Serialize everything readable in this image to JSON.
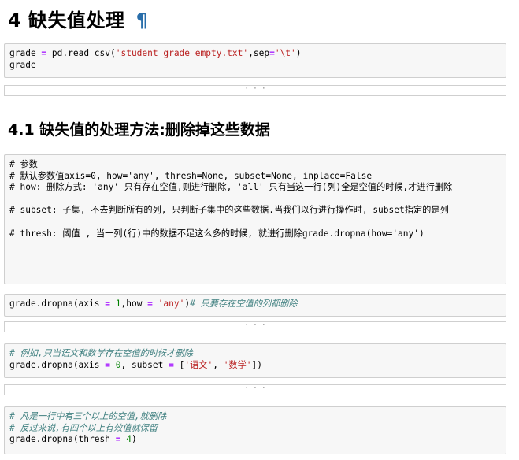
{
  "heading1": {
    "text": "4  缺失值处理",
    "pilcrow": "¶"
  },
  "heading2": {
    "text": "4.1  缺失值的处理方法:删除掉这些数据"
  },
  "cell1": {
    "line1_a": "grade ",
    "line1_eq": "=",
    "line1_b": " pd.read_csv(",
    "line1_str1": "'student_grade_empty.txt'",
    "line1_c": ",sep",
    "line1_eq2": "=",
    "line1_str2": "'\\t'",
    "line1_d": ")",
    "line2": "grade"
  },
  "cell2": {
    "text": "# 参数\n# 默认参数值axis=0, how='any', thresh=None, subset=None, inplace=False\n# how: 删除方式: 'any' 只有存在空值,则进行删除, 'all' 只有当这一行(列)全是空值的时候,才进行删除\n\n# subset: 子集, 不去判断所有的列, 只判断子集中的这些数据.当我们以行进行操作时, subset指定的是列\n\n# thresh: 阈值 , 当一列(行)中的数据不足这么多的时候, 就进行删除grade.dropna(how='any')"
  },
  "cell3": {
    "a": "grade.dropna(axis ",
    "eq1": "=",
    "num1": " 1",
    "b": ",how ",
    "eq2": "=",
    "str1": " 'any'",
    "c": ")",
    "comment": "# 只要存在空值的列都删除"
  },
  "cell4": {
    "comment": "# 例如,只当语文和数学存在空值的时候才删除",
    "a": "grade.dropna(axis ",
    "eq1": "=",
    "num1": " 0",
    "b": ", subset ",
    "eq2": "=",
    "c": " [",
    "str1": "'语文'",
    "d": ", ",
    "str2": "'数学'",
    "e": "])"
  },
  "cell5": {
    "comment1": "# 凡是一行中有三个以上的空值,就删除",
    "comment2": "# 反过来说,有四个以上有效值就保留",
    "a": "grade.dropna(thresh ",
    "eq1": "=",
    "num1": " 4",
    "b": ")"
  },
  "collapsed_marker": "· · ·"
}
